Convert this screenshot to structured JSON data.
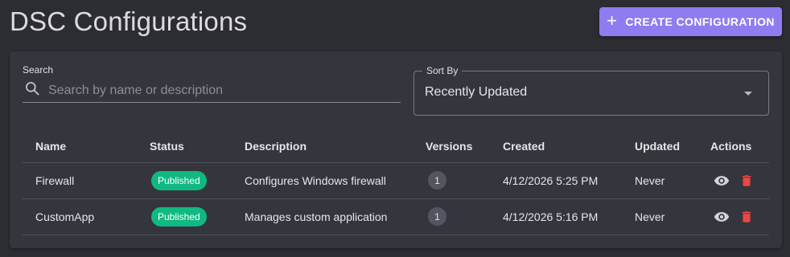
{
  "header": {
    "title": "DSC Configurations",
    "create_button": "CREATE CONFIGURATION"
  },
  "filters": {
    "search_label": "Search",
    "search_placeholder": "Search by name or description",
    "sort_label": "Sort By",
    "sort_value": "Recently Updated"
  },
  "table": {
    "columns": [
      "Name",
      "Status",
      "Description",
      "Versions",
      "Created",
      "Updated",
      "Actions"
    ],
    "rows": [
      {
        "name": "Firewall",
        "status": "Published",
        "description": "Configures Windows firewall",
        "versions": "1",
        "created": "4/12/2026 5:25 PM",
        "updated": "Never"
      },
      {
        "name": "CustomApp",
        "status": "Published",
        "description": "Manages custom application",
        "versions": "1",
        "created": "4/12/2026 5:16 PM",
        "updated": "Never"
      }
    ]
  },
  "colors": {
    "accent": "#8e7cf0",
    "status_published": "#10b981",
    "delete": "#ef4444"
  },
  "icons": [
    "plus-icon",
    "search-icon",
    "chevron-down-icon",
    "eye-icon",
    "trash-icon"
  ]
}
